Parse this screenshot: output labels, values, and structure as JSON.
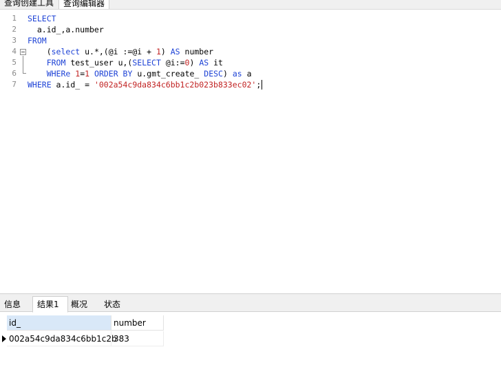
{
  "tabs": [
    {
      "label": "查询创建工具"
    },
    {
      "label": "查询编辑器"
    }
  ],
  "editor": {
    "line_numbers": [
      "1",
      "2",
      "3",
      "4",
      "5",
      "6",
      "7"
    ],
    "lines": [
      [
        {
          "t": "SELECT",
          "c": "kw"
        }
      ],
      [
        {
          "t": "  a.id_,a.number",
          "c": ""
        }
      ],
      [
        {
          "t": "FROM",
          "c": "kw"
        }
      ],
      [
        {
          "t": "    (",
          "c": ""
        },
        {
          "t": "select",
          "c": "kw"
        },
        {
          "t": " u.*,(@i :=@i + ",
          "c": ""
        },
        {
          "t": "1",
          "c": "num"
        },
        {
          "t": ") ",
          "c": ""
        },
        {
          "t": "AS",
          "c": "kw"
        },
        {
          "t": " number",
          "c": ""
        }
      ],
      [
        {
          "t": "    ",
          "c": ""
        },
        {
          "t": "FROM",
          "c": "kw"
        },
        {
          "t": " test_user u,(",
          "c": ""
        },
        {
          "t": "SELECT",
          "c": "kw"
        },
        {
          "t": " @i:=",
          "c": ""
        },
        {
          "t": "0",
          "c": "num"
        },
        {
          "t": ") ",
          "c": ""
        },
        {
          "t": "AS",
          "c": "kw"
        },
        {
          "t": " it",
          "c": ""
        }
      ],
      [
        {
          "t": "    ",
          "c": ""
        },
        {
          "t": "WHERe",
          "c": "kw"
        },
        {
          "t": " ",
          "c": ""
        },
        {
          "t": "1",
          "c": "num"
        },
        {
          "t": "=",
          "c": ""
        },
        {
          "t": "1",
          "c": "num"
        },
        {
          "t": " ",
          "c": ""
        },
        {
          "t": "ORDER BY",
          "c": "kw"
        },
        {
          "t": " u.gmt_create_ ",
          "c": ""
        },
        {
          "t": "DESC",
          "c": "kw"
        },
        {
          "t": ") ",
          "c": ""
        },
        {
          "t": "as",
          "c": "kw"
        },
        {
          "t": " a",
          "c": ""
        }
      ],
      [
        {
          "t": "WHERE",
          "c": "kw"
        },
        {
          "t": " a.id_ = ",
          "c": ""
        },
        {
          "t": "'002a54c9da834c6bb1c2b023b833ec02'",
          "c": "str"
        },
        {
          "t": ";",
          "c": ""
        }
      ]
    ]
  },
  "bottom_tabs": [
    {
      "label": "信息"
    },
    {
      "label": "结果1"
    },
    {
      "label": "概况"
    },
    {
      "label": "状态"
    }
  ],
  "result": {
    "columns": [
      "id_",
      "number"
    ],
    "rows": [
      [
        "002a54c9da834c6bb1c2b",
        "383"
      ]
    ]
  },
  "colors": {
    "keyword": "#1e43d6",
    "number_literal": "#c12222",
    "string_literal": "#c12222",
    "active_header": "#d9e8f8"
  }
}
